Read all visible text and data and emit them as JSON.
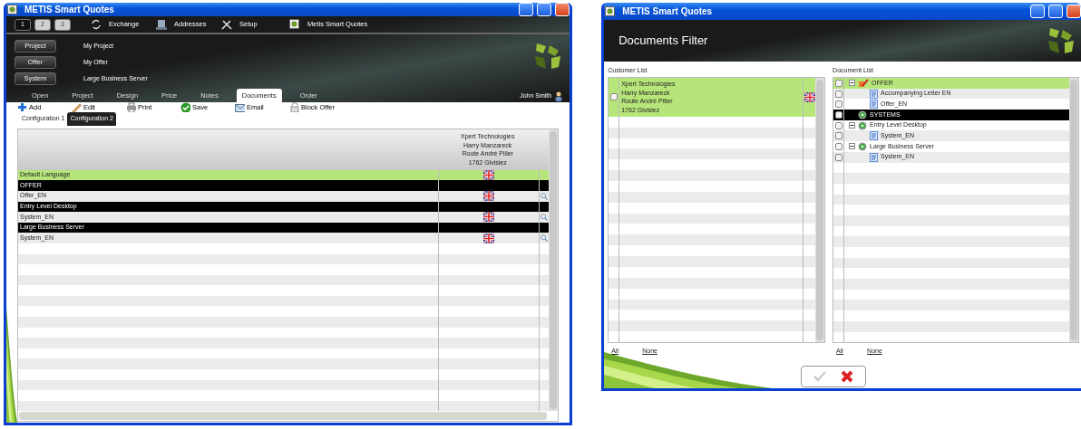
{
  "main_window": {
    "title": "METIS Smart Quotes",
    "page_buttons": [
      {
        "label": "1",
        "selected": true
      },
      {
        "label": "2",
        "selected": false
      },
      {
        "label": "3",
        "selected": false
      }
    ],
    "toolbar": [
      {
        "kind": "exchange",
        "label": "Exchange"
      },
      {
        "kind": "addresses",
        "label": "Addresses"
      },
      {
        "kind": "setup",
        "label": "Setup"
      },
      {
        "kind": "app",
        "label": "Metis Smart Quotes"
      }
    ],
    "context": [
      {
        "label": "Project",
        "value": "My Project"
      },
      {
        "label": "Offer",
        "value": "My Offer"
      },
      {
        "label": "System",
        "value": "Large Business Server"
      }
    ],
    "tabs": [
      {
        "label": "Open",
        "selected": false
      },
      {
        "label": "Project",
        "selected": false
      },
      {
        "label": "Design",
        "selected": false
      },
      {
        "label": "Price",
        "selected": false
      },
      {
        "label": "Notes",
        "selected": false
      },
      {
        "label": "Documents",
        "selected": true
      },
      {
        "label": "Order",
        "selected": false
      }
    ],
    "user": "John Smith",
    "actions": [
      {
        "kind": "add",
        "label": "Add"
      },
      {
        "kind": "edit",
        "label": "Edit"
      },
      {
        "kind": "print",
        "label": "Print"
      },
      {
        "kind": "save",
        "label": "Save"
      },
      {
        "kind": "email",
        "label": "Email"
      },
      {
        "kind": "lock",
        "label": "Block Offer"
      }
    ],
    "config_tabs": [
      {
        "label": "Configuration 1",
        "selected": false
      },
      {
        "label": "Configuration 2",
        "selected": true
      }
    ],
    "grid": {
      "header_lines": [
        "Xpert Technologies",
        "Harry Manzareck",
        "Route André Piller",
        "1762 Givisiez"
      ],
      "rows": [
        {
          "kind": "language",
          "label": "Default Language",
          "selected": true
        },
        {
          "kind": "group",
          "label": "OFFER",
          "selected": false
        },
        {
          "kind": "document",
          "label": "Offer_EN",
          "selected": false
        },
        {
          "kind": "group",
          "label": "Entry Level Desktop",
          "selected": false
        },
        {
          "kind": "document",
          "label": "System_EN",
          "selected": false
        },
        {
          "kind": "group",
          "label": "Large Business Server",
          "selected": false
        },
        {
          "kind": "document",
          "label": "System_EN",
          "selected": false
        }
      ]
    }
  },
  "filter_window": {
    "title": "METIS Smart Quotes",
    "heading": "Documents Filter",
    "customer_list": {
      "label": "Customer List",
      "items": [
        {
          "lines": [
            "Xpert Technologies",
            "Harry Manzareck",
            "Route André Piller",
            "1762 Givisiez"
          ],
          "checked": false,
          "selected": true
        }
      ],
      "links": [
        "All",
        "None"
      ]
    },
    "document_list": {
      "label": "Document List",
      "items": [
        {
          "kind": "offer",
          "label": "OFFER",
          "checked": false,
          "selected": true,
          "expanded": true,
          "children": [
            {
              "label": "Accompanying Letter EN",
              "checked": false
            },
            {
              "label": "Offer_EN",
              "checked": false
            }
          ]
        },
        {
          "kind": "systems",
          "label": "SYSTEMS",
          "checked": false,
          "selected": false
        },
        {
          "kind": "system",
          "label": "Entry Level Desktop",
          "checked": false,
          "selected": false,
          "expanded": true,
          "children": [
            {
              "label": "System_EN",
              "checked": false
            }
          ]
        },
        {
          "kind": "system",
          "label": "Large Business Server",
          "checked": false,
          "selected": false,
          "expanded": true,
          "children": [
            {
              "label": "System_EN",
              "checked": false
            }
          ]
        }
      ],
      "links": [
        "All",
        "None"
      ]
    },
    "buttons": [
      {
        "kind": "ok",
        "disabled": true
      },
      {
        "kind": "cancel",
        "disabled": false
      }
    ]
  }
}
